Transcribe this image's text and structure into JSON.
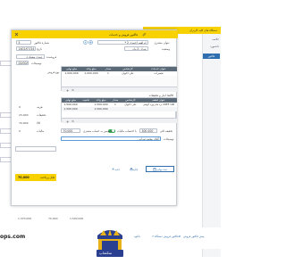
{
  "app": {
    "window_title": "فاکتور فروش و خدمات",
    "back_title": "دستگاه های کلیه کاربران",
    "back_sidebar": [
      "خلاصه",
      "داشبورد",
      "فاکتور"
    ]
  },
  "header": {
    "invoice_no_label": "شماره فاکتور",
    "invoice_no_value": "5",
    "date_label": "تاریخ",
    "date_value": "1402/07/24",
    "customer_label": "عنوان مشتری",
    "customer_value": "* 2 ابراهیم احمدی",
    "status_label": "وضعیت",
    "status_value": "تهران 2 وان",
    "seller_label": "فروشنده",
    "seller_value": "عهدی مشکری",
    "misc_label": "توضیحات",
    "misc_value": "00/00/0",
    "sell_currency_label": "نوع فروش"
  },
  "services_table": {
    "headers": [
      "عنوان خدمات",
      "کارشناس",
      "مقدار",
      "مبلغ واحد",
      "مبلغ نهایی"
    ],
    "rows": [
      {
        "title": "تعمیرات",
        "expert": "علی اخوان",
        "qty": "1",
        "unit": "1,000,000",
        "total": "1,000,000"
      }
    ],
    "footer_qty": "",
    "footer_total": "70,000"
  },
  "goods_table": {
    "section_title": "کالاها، انبار و تخفیفات",
    "headers": [
      "عنوان قطعه",
      "کارشناس",
      "مقدار",
      "مبلغ واحد",
      "تخفیف",
      "مبلغ نهایی"
    ],
    "rows": [
      {
        "title": "برد مادربورد گوشی CREF 100",
        "expert": "علی اخوان",
        "qty": "1",
        "unit": "1,500,000",
        "discount": "",
        "total": "1,500,000"
      }
    ],
    "summary_row": {
      "unit": "1,500,000",
      "total": "1,500,000"
    }
  },
  "totals": {
    "discount_label": "تخفیف کلی",
    "discount_value": "300,000",
    "tax_label": "با احتساب مالیات",
    "tax_toggle_label": "تخصیص به حساب مشتری",
    "final_label": "مبلغ نهایی",
    "final_value": "70,000",
    "notes_label": "توضیحات",
    "notes_value": "آقای محمد تهرانی"
  },
  "left_panel": {
    "items": [
      {
        "label": "هزینه",
        "value": "0"
      },
      {
        "label": "تخفیفات",
        "value": "15,000"
      },
      {
        "label": "کالا",
        "value": "70,000"
      },
      {
        "label": "مالیات",
        "value": "0"
      }
    ],
    "input_placeholder": "",
    "highlight_value": "70,000",
    "highlight_label": "قابل پرداخت"
  },
  "footer_buttons": {
    "save": "ثبت نهایی",
    "print": "چاپ",
    "new": "جدید"
  },
  "back_row": {
    "values": [
      "1,370,000",
      "70,000",
      "1,500,000"
    ]
  },
  "bottom_bar": {
    "link1": "پیش فاکتور فروش",
    "link2": "فاکتور فروش دستگاه 7#",
    "link3": "دانلود"
  },
  "watermark": {
    "brand": "نمکشاپ",
    "site": "ops.com"
  },
  "colors": {
    "accent_yellow": "#f7d200",
    "header_gray": "#5c6a78",
    "blue_button": "#2f6fb0",
    "logo_blue": "#2a3f8f",
    "logo_gold": "#e7b21a"
  }
}
